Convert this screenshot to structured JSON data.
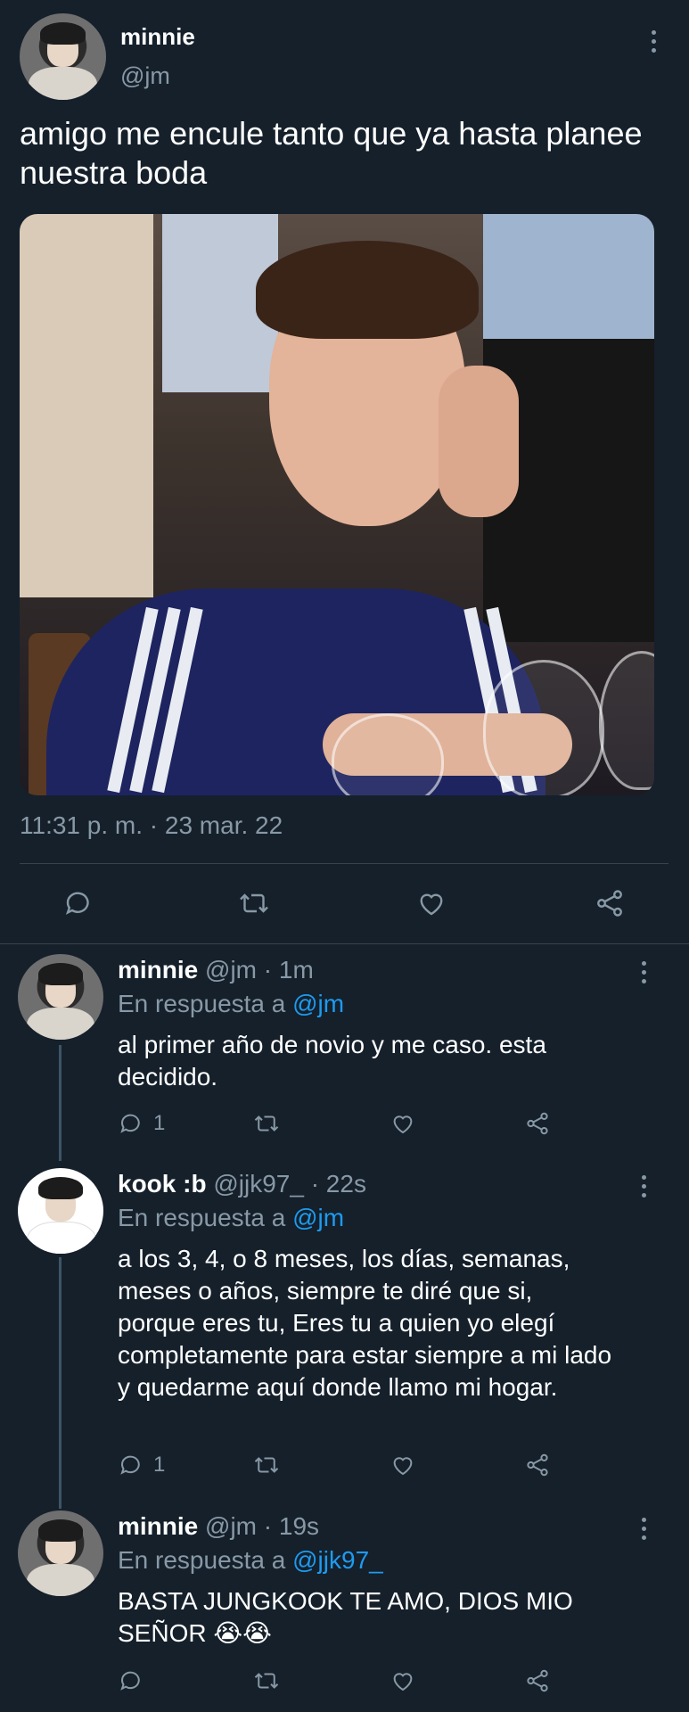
{
  "main": {
    "name": "minnie",
    "handle": "@jm",
    "text": "amigo me encule tanto que ya hasta planee nuestra boda",
    "timestamp": "11:31 p. m. · 23 mar. 22"
  },
  "replies": [
    {
      "name": "minnie",
      "meta": "@jm · 1m",
      "reply_prefix": "En respuesta a",
      "reply_to": "@jm",
      "text": "al primer año de novio y me caso. esta decidido.",
      "reply_count": "1"
    },
    {
      "name": "kook :b",
      "meta": "@jjk97_ · 22s",
      "reply_prefix": "En respuesta a",
      "reply_to": "@jm",
      "text": "a los 3, 4, o 8 meses, los días, semanas, meses o años, siempre te diré que si, porque eres tu, Eres tu a quien yo elegí completamente para estar siempre a mi lado y quedarme aquí donde llamo mi hogar.",
      "reply_count": "1"
    },
    {
      "name": "minnie",
      "meta": "@jm · 19s",
      "reply_prefix": "En respuesta a",
      "reply_to": "@jjk97_",
      "text": "BASTA JUNGKOOK TE AMO, DIOS MIO SEÑOR 😭😭",
      "reply_count": ""
    }
  ],
  "icons": {
    "reply": "reply-icon",
    "retweet": "retweet-icon",
    "like": "heart-icon",
    "share": "share-icon",
    "more": "more-icon"
  },
  "colors": {
    "background": "#15202b",
    "muted": "#8899a6",
    "link": "#1d9bf0",
    "divider": "#38444d"
  }
}
